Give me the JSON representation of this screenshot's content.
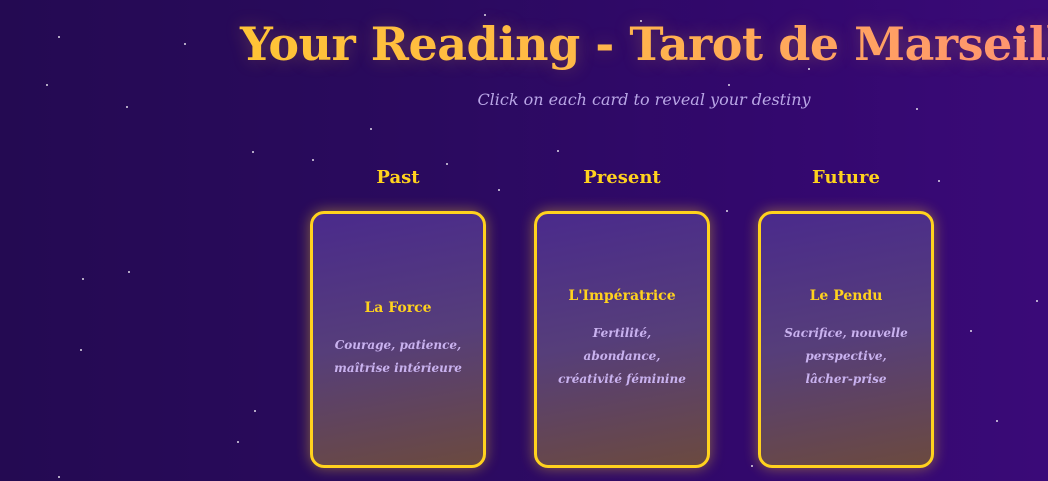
{
  "header": {
    "title": "Your Reading - Tarot de Marseille",
    "subtitle": "Click on each card to reveal your destiny"
  },
  "spread": [
    {
      "position": "Past",
      "card_name": "La Force",
      "meaning": "Courage, patience, maîtrise intérieure"
    },
    {
      "position": "Present",
      "card_name": "L'Impératrice",
      "meaning": "Fertilité, abondance, créativité féminine"
    },
    {
      "position": "Future",
      "card_name": "Le Pendu",
      "meaning": "Sacrifice, nouvelle perspective, lâcher-prise"
    }
  ],
  "colors": {
    "background": "#2a0a5e",
    "accent": "#ffd21e",
    "title_gradient_end": "#ff8f7a",
    "subtitle": "#b9a6e6",
    "meaning_text": "#c9b2ef"
  }
}
